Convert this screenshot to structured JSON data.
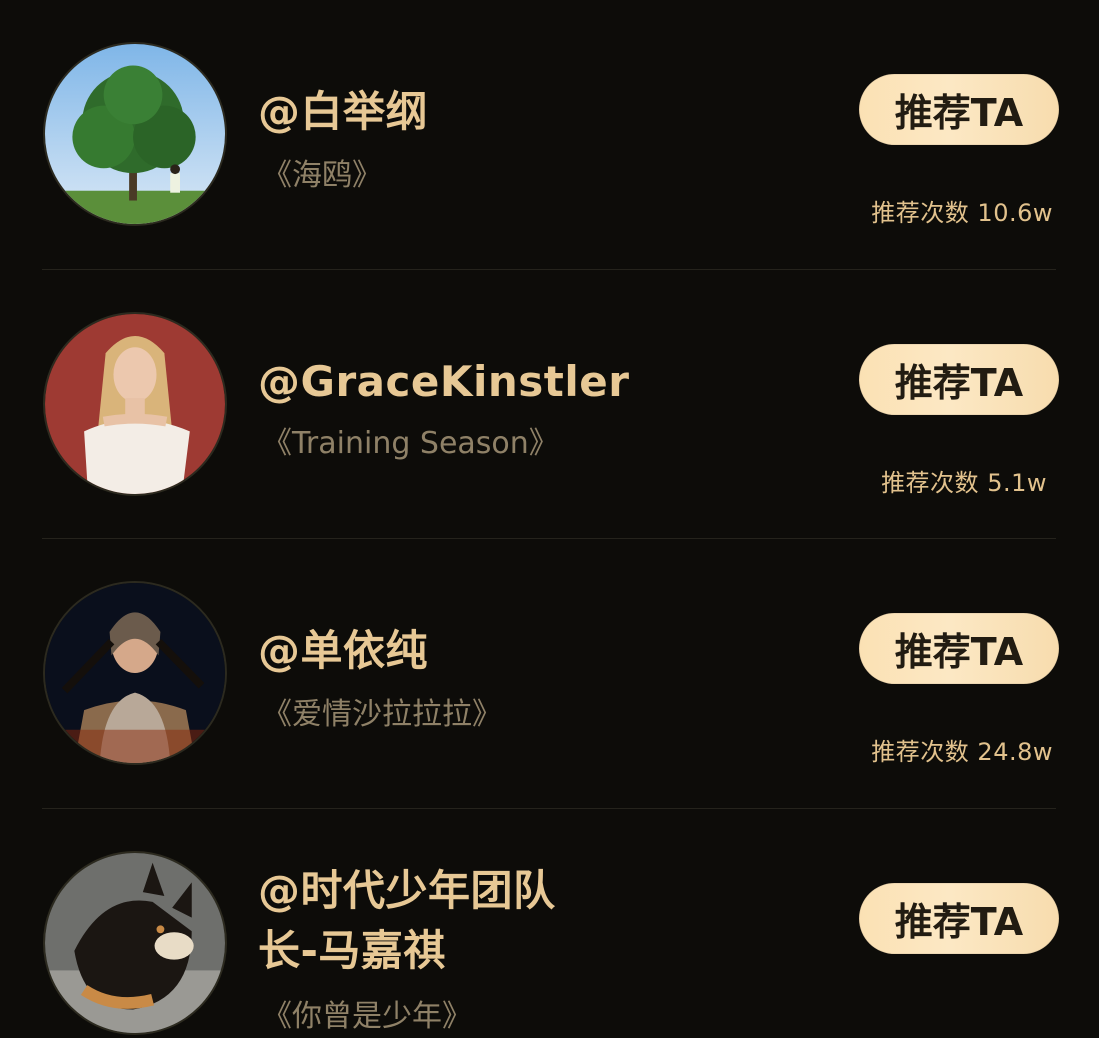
{
  "accent_color": "#e7c895",
  "button_color": "#fbe1b4",
  "background_color": "#0d0c09",
  "items": [
    {
      "name": "@白举纲",
      "song": "《海鸥》",
      "button_label": "推荐TA",
      "count_label": "推荐次数",
      "count": "10.6w"
    },
    {
      "name": "@GraceKinstler",
      "song": "《Training Season》",
      "button_label": "推荐TA",
      "count_label": "推荐次数",
      "count": "5.1w"
    },
    {
      "name": "@单依纯",
      "song": "《爱情沙拉拉拉》",
      "button_label": "推荐TA",
      "count_label": "推荐次数",
      "count": "24.8w"
    },
    {
      "name_line1": "@时代少年团队",
      "name_line2": "长-马嘉祺",
      "song": "《你曾是少年》",
      "button_label": "推荐TA"
    }
  ]
}
